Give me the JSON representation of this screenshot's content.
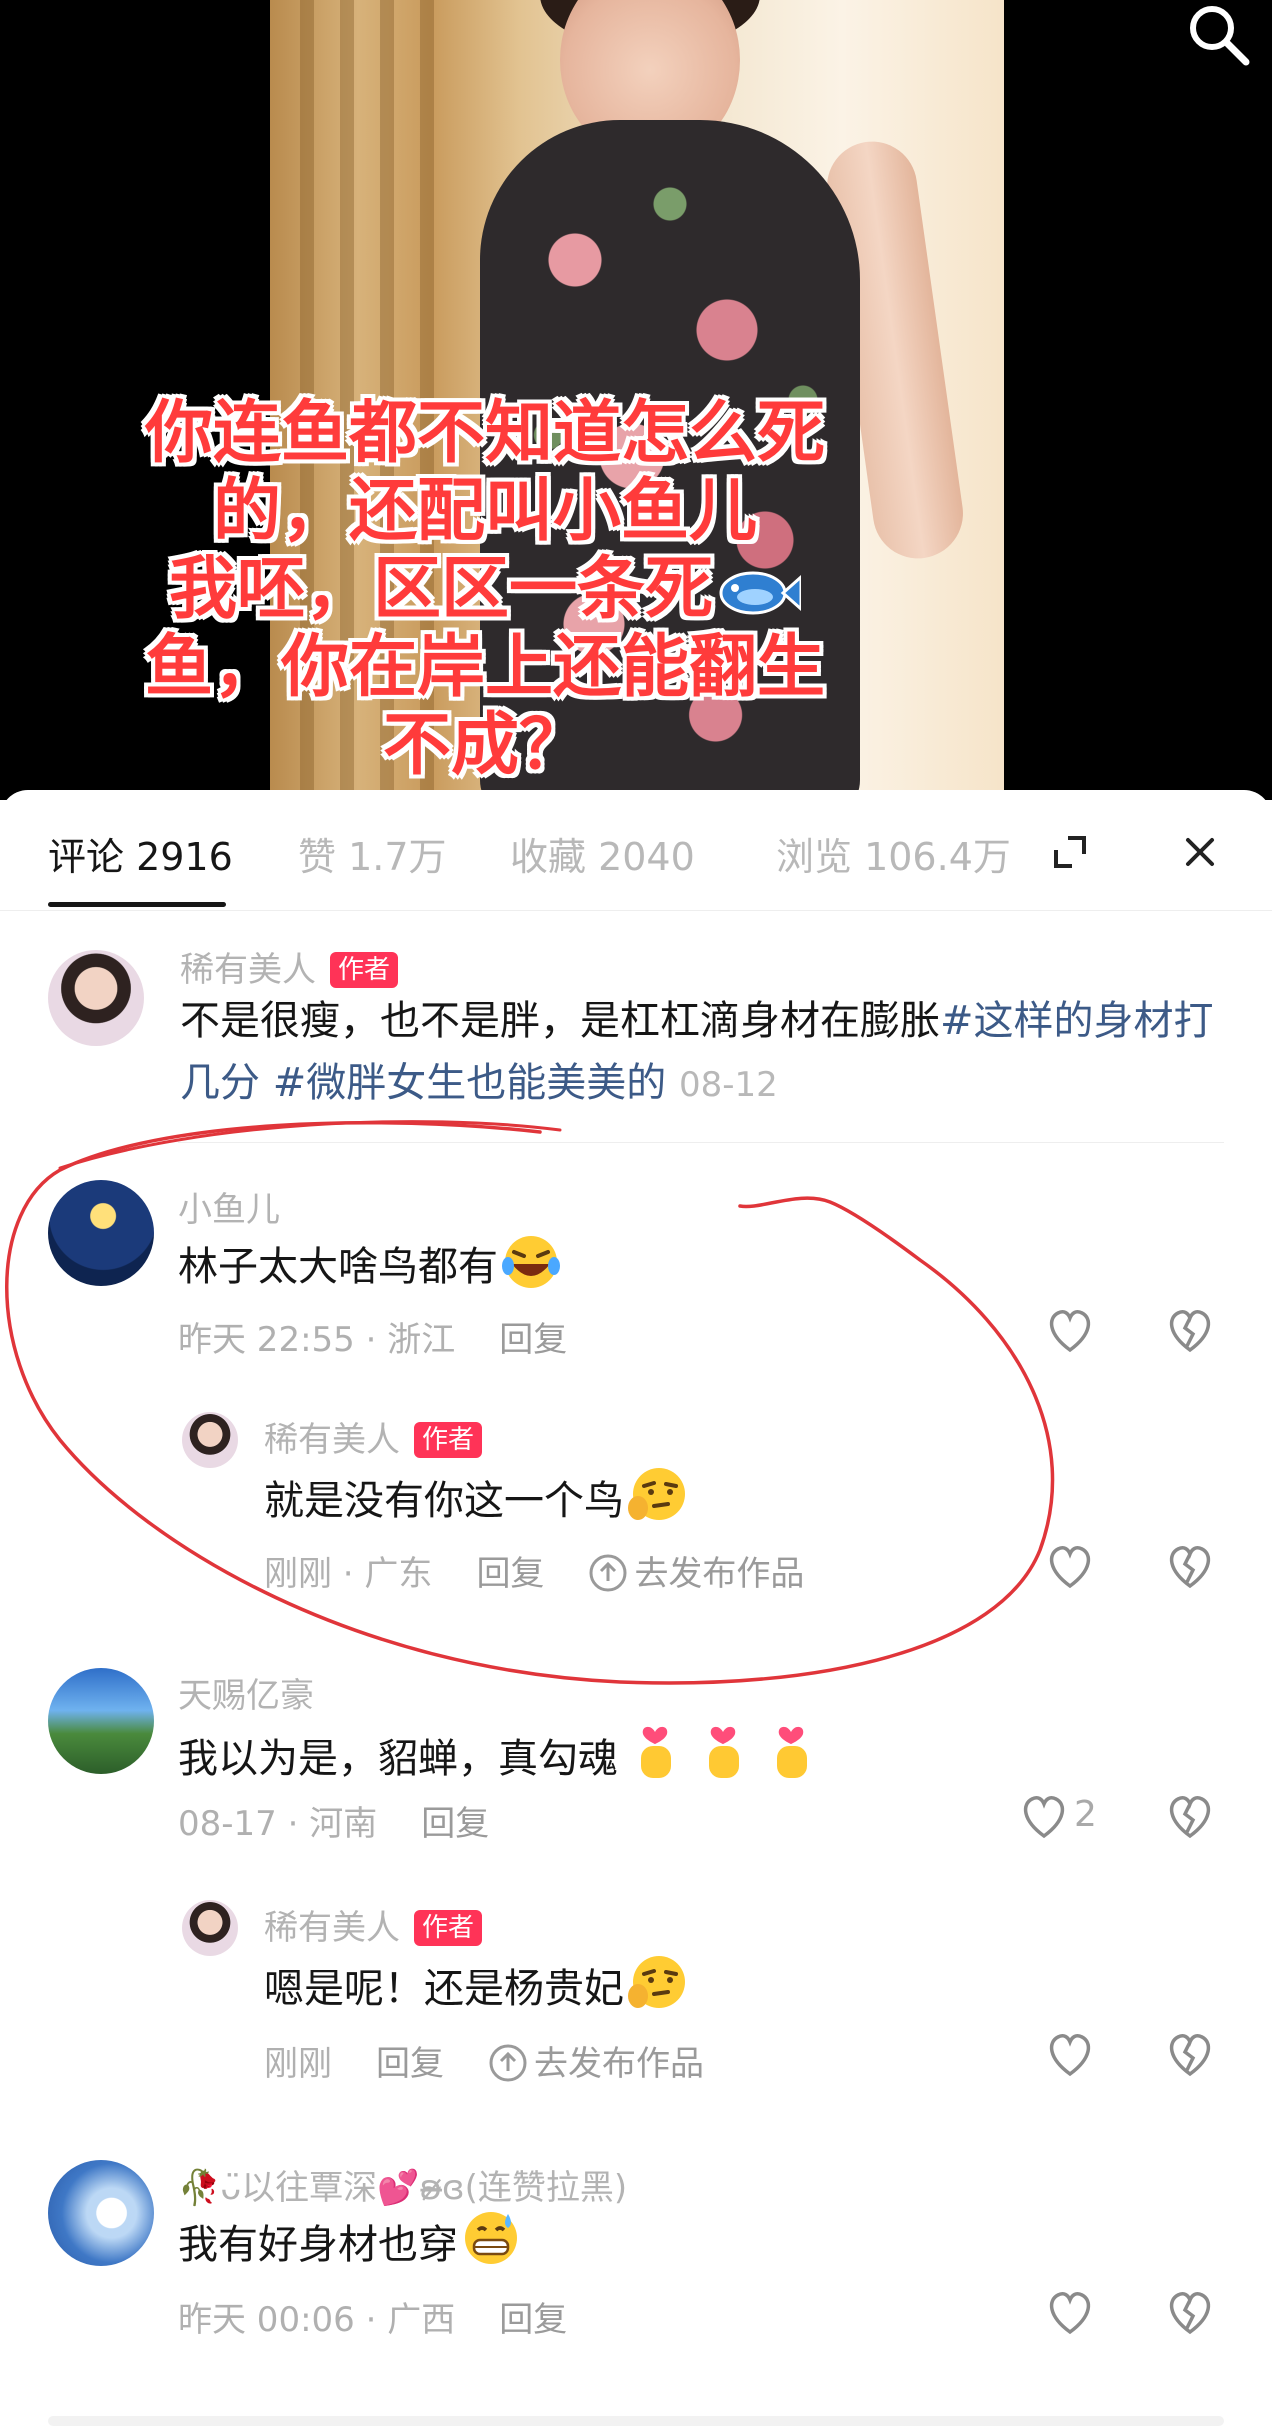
{
  "video": {
    "caption_lines": [
      "你连鱼都不知道怎么死",
      "的，还配叫小鱼儿",
      "我呸，区区一条死",
      "鱼，你在岸上还能翻生",
      "不成？"
    ]
  },
  "tabs": [
    {
      "label": "评论 2916"
    },
    {
      "label": "赞 1.7万"
    },
    {
      "label": "收藏 2040"
    },
    {
      "label": "浏览 106.4万"
    }
  ],
  "comments": {
    "c1": {
      "user": "稀有美人",
      "badge": "作者",
      "text_plain": "不是很瘦，也不是胖，是杠杠滴身材在膨胀",
      "text_tag1": "#这样的身材打几分",
      "text_tag2": "#微胖女生也能美美的",
      "date": "08-12"
    },
    "c2": {
      "user": "小鱼儿",
      "text": "林子太大啥鸟都有",
      "meta": "昨天 22:55 · 浙江",
      "reply_label": "回复",
      "reply": {
        "user": "稀有美人",
        "badge": "作者",
        "text": "就是没有你这一个鸟",
        "meta": "刚刚 · 广东",
        "reply_label": "回复",
        "publish_label": "去发布作品"
      }
    },
    "c3": {
      "user": "天赐亿豪",
      "text": "我以为是，貂蝉，真勾魂",
      "meta": "08-17 · 河南",
      "reply_label": "回复",
      "like_count": "2",
      "reply": {
        "user": "稀有美人",
        "badge": "作者",
        "text": "嗯是呢！还是杨贵妃",
        "meta": "刚刚",
        "reply_label": "回复",
        "publish_label": "去发布作品"
      }
    },
    "c4": {
      "user": "🥀ᴗ̈以往覃深💕ʚ̴̶̷̷ɞ(连赞拉黑)",
      "text": "我有好身材也穿",
      "meta": "昨天 00:06 · 广西",
      "reply_label": "回复"
    }
  },
  "colors": {
    "badge": "#ff3357",
    "hashtag": "#3c5a87",
    "annotation": "#e0353a",
    "caption": "#ff3b3b"
  },
  "icons": [
    "search-icon",
    "expand-icon",
    "close-icon",
    "heart-icon",
    "broken-heart-icon",
    "upload-icon"
  ]
}
